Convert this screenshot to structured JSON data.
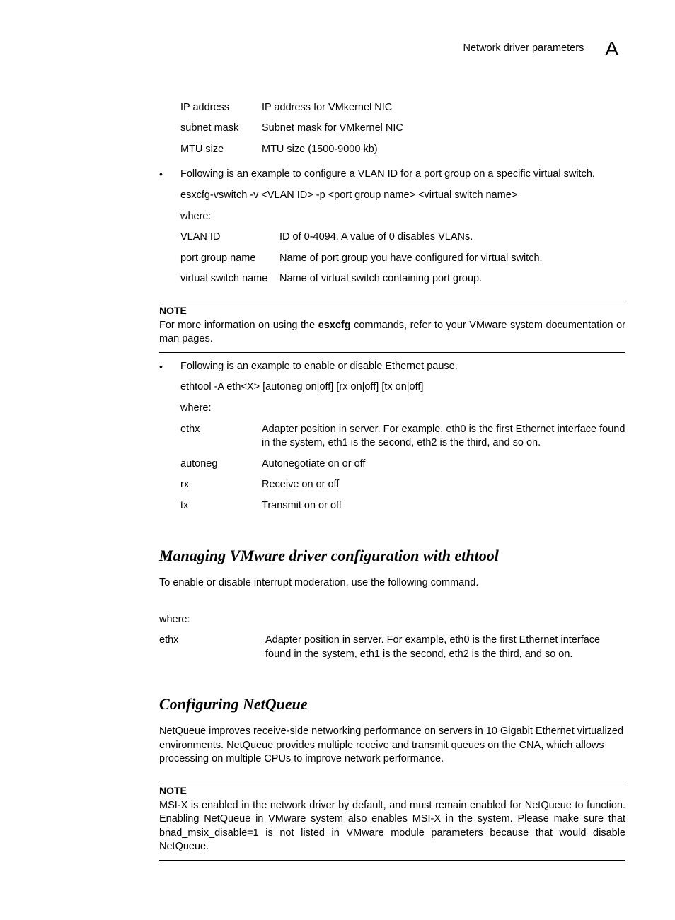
{
  "header": {
    "title": "Network driver parameters",
    "letter": "A"
  },
  "table1": {
    "rows": [
      {
        "term": "IP address",
        "desc": "IP address for VMkernel NIC"
      },
      {
        "term": "subnet mask",
        "desc": "Subnet mask for VMkernel NIC"
      },
      {
        "term": "MTU size",
        "desc": "MTU size (1500-9000 kb)"
      }
    ]
  },
  "bullet_vlan": {
    "intro": "Following is an example to configure a VLAN ID for a port group on a specific virtual switch.",
    "cmd": "esxcfg-vswitch -v <VLAN ID> -p <port group name> <virtual switch name>",
    "where": "where:",
    "rows": [
      {
        "term": "VLAN ID",
        "desc": "ID of 0-4094. A value of 0 disables VLANs."
      },
      {
        "term": "port group name",
        "desc": "Name of port group you have configured for virtual switch."
      },
      {
        "term": "virtual switch name",
        "desc": "Name of virtual switch containing port group."
      }
    ]
  },
  "note1": {
    "label": "NOTE",
    "before_bold": "For more information on using the ",
    "bold": "esxcfg",
    "after_bold": " commands, refer to your VMware system documentation or man pages."
  },
  "bullet_pause": {
    "intro": "Following is an example to enable or disable Ethernet pause.",
    "cmd": "ethtool -A eth<X> [autoneg on|off] [rx on|off] [tx on|off]",
    "where": "where:",
    "rows": [
      {
        "term": "ethx",
        "desc": "Adapter position in server. For example, eth0 is the first Ethernet interface found in the system, eth1 is the second, eth2 is the third, and so on."
      },
      {
        "term": "autoneg",
        "desc": "Autonegotiate on or off"
      },
      {
        "term": "rx",
        "desc": "Receive on or off"
      },
      {
        "term": "tx",
        "desc": "Transmit on or off"
      }
    ]
  },
  "section_ethtool": {
    "title": "Managing VMware driver configuration with ethtool",
    "intro": "To enable or disable interrupt moderation, use the following command.",
    "where": "where:",
    "rows": [
      {
        "term": "ethx",
        "desc": "Adapter position in server. For example, eth0 is the first Ethernet interface found in the system, eth1 is the second, eth2 is the third, and so on."
      }
    ]
  },
  "section_netqueue": {
    "title": "Configuring NetQueue",
    "body": "NetQueue improves receive-side networking performance on servers in 10 Gigabit Ethernet virtualized environments. NetQueue provides multiple receive and transmit queues on the CNA, which allows processing on multiple CPUs to improve network performance."
  },
  "note2": {
    "label": "NOTE",
    "body": "MSI-X is enabled in the network driver by default, and must remain enabled for NetQueue to function. Enabling NetQueue in VMware system also enables MSI-X in the system. Please make sure that bnad_msix_disable=1 is not listed in VMware module parameters because that would disable NetQueue."
  }
}
